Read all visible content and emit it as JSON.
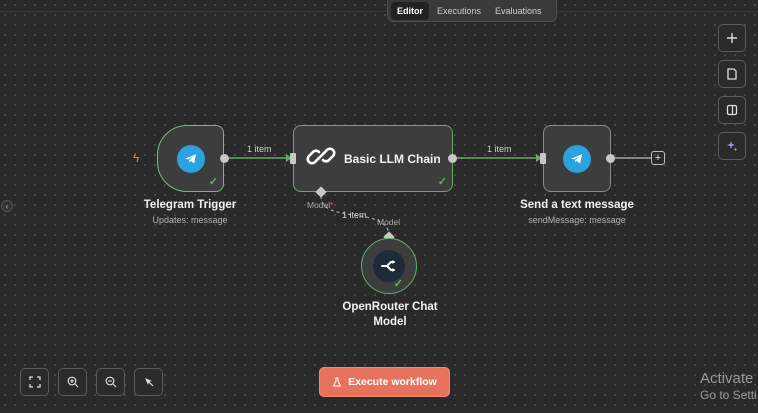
{
  "tabs": [
    {
      "label": "Editor",
      "active": true
    },
    {
      "label": "Executions",
      "active": false
    },
    {
      "label": "Evaluations",
      "active": false
    }
  ],
  "right_toolbar": [
    {
      "icon": "plus-icon"
    },
    {
      "icon": "sticky-note-icon"
    },
    {
      "icon": "panel-icon"
    },
    {
      "icon": "sparkle-icon"
    }
  ],
  "nodes": {
    "telegram_trigger": {
      "title": "Telegram Trigger",
      "subtitle": "Updates: message",
      "icon": "telegram-icon"
    },
    "llm_chain": {
      "title": "Basic LLM Chain",
      "icon": "link-chain-icon"
    },
    "send_message": {
      "title": "Send a text message",
      "subtitle": "sendMessage: message",
      "icon": "telegram-icon"
    },
    "openrouter_model": {
      "title_line1": "OpenRouter Chat",
      "title_line2": "Model",
      "icon": "openrouter-icon"
    }
  },
  "edges": {
    "trigger_to_chain": "1 item",
    "chain_to_send": "1 item",
    "model_to_chain": "1 item"
  },
  "ports": {
    "chain_model_port": "Model",
    "chain_model_required": "*",
    "model_output_port": "Model"
  },
  "bottom_toolbar": [
    {
      "icon": "fit-view-icon"
    },
    {
      "icon": "zoom-in-icon"
    },
    {
      "icon": "zoom-out-icon"
    },
    {
      "icon": "tidy-up-icon"
    }
  ],
  "execute_button": "Execute workflow",
  "watermark": {
    "line1": "Activate",
    "line2": "Go to Setti"
  },
  "colors": {
    "accent": "#e8735c",
    "success": "#5fb35f",
    "telegram": "#2aa3e0",
    "canvas": "#2a2a2a"
  }
}
